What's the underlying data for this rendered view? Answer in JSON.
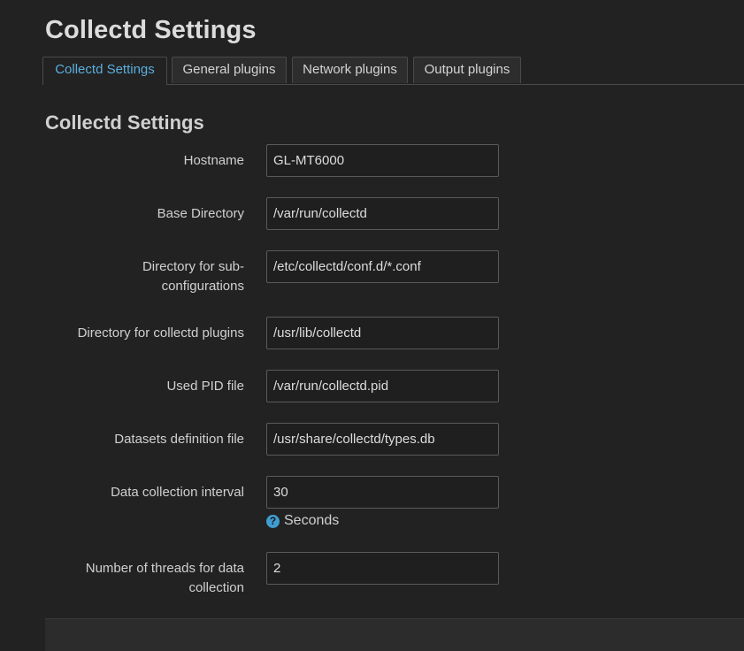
{
  "page": {
    "title": "Collectd Settings"
  },
  "tabs": [
    {
      "label": "Collectd Settings",
      "active": true
    },
    {
      "label": "General plugins",
      "active": false
    },
    {
      "label": "Network plugins",
      "active": false
    },
    {
      "label": "Output plugins",
      "active": false
    }
  ],
  "section": {
    "title": "Collectd Settings"
  },
  "fields": [
    {
      "label": "Hostname",
      "value": "GL-MT6000"
    },
    {
      "label": "Base Directory",
      "value": "/var/run/collectd"
    },
    {
      "label": "Directory for sub-configurations",
      "value": "/etc/collectd/conf.d/*.conf"
    },
    {
      "label": "Directory for collectd plugins",
      "value": "/usr/lib/collectd"
    },
    {
      "label": "Used PID file",
      "value": "/var/run/collectd.pid"
    },
    {
      "label": "Datasets definition file",
      "value": "/usr/share/collectd/types.db"
    },
    {
      "label": "Data collection interval",
      "value": "30",
      "hint": "Seconds"
    },
    {
      "label": "Number of threads for data collection",
      "value": "2"
    }
  ],
  "icons": {
    "hint": "help-icon"
  },
  "colors": {
    "background": "#222222",
    "active_tab_text": "#5aaedd",
    "help_icon": "#3f9dd1"
  }
}
